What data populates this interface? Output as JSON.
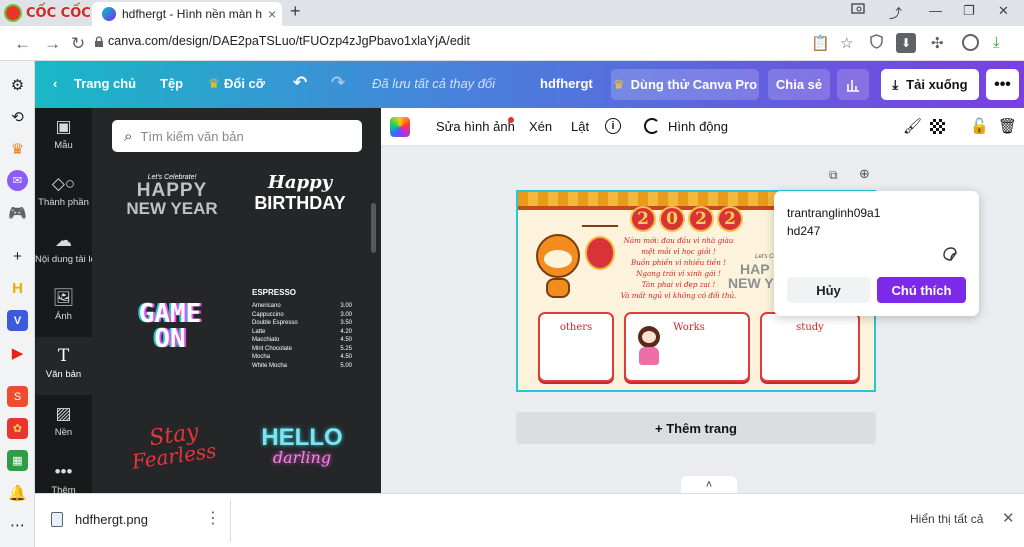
{
  "browser": {
    "brand": "CỐC CỐC",
    "tab_title": "hdfhergt - Hình nền màn hình",
    "url": "canva.com/design/DAE2paTSLuo/tFUOzp4zJgPbavo1xlaYjA/edit"
  },
  "canva_top": {
    "home": "Trang chủ",
    "file": "Tệp",
    "resize": "Đổi cỡ",
    "saved": "Đã lưu tất cả thay đổi",
    "design_name": "hdfhergt",
    "try_pro": "Dùng thử Canva Pro",
    "share": "Chia sẻ",
    "download": "Tải xuống"
  },
  "rail": {
    "items": [
      {
        "label": "Mẫu",
        "icon": "template-icon"
      },
      {
        "label": "Thành phần",
        "icon": "elements-icon"
      },
      {
        "label": "Nội dung tải lên",
        "icon": "upload-icon"
      },
      {
        "label": "Ảnh",
        "icon": "photo-icon"
      },
      {
        "label": "Văn bản",
        "icon": "text-icon"
      },
      {
        "label": "Nền",
        "icon": "background-icon"
      },
      {
        "label": "Thêm",
        "icon": "more-icon"
      }
    ]
  },
  "panel": {
    "search_placeholder": "Tìm kiếm văn bản",
    "templates": {
      "hny_small": "Let's Celebrate!",
      "hny_l1": "HAPPY",
      "hny_l2": "NEW YEAR",
      "hb_l1": "Happy",
      "hb_l2": "BIRTHDAY",
      "go_l1": "GAME",
      "go_l2": "ON",
      "menu_title": "ESPRESSO",
      "menu_items": [
        {
          "name": "Americano",
          "price": "3.00"
        },
        {
          "name": "Cappuccino",
          "price": "3.00"
        },
        {
          "name": "Double Espresso",
          "price": "3.50"
        },
        {
          "name": "Latte",
          "price": "4.20"
        },
        {
          "name": "Macchiato",
          "price": "4.50"
        },
        {
          "name": "Mint Chocolate",
          "price": "5.25"
        },
        {
          "name": "Mocha",
          "price": "4.50"
        },
        {
          "name": "White Mocha",
          "price": "5.00"
        }
      ],
      "sf_l1": "Stay",
      "sf_l2": "Fearless",
      "hd_l1": "HELLO",
      "hd_l2": "darling"
    }
  },
  "editor_toolbar": {
    "edit_image": "Sửa hình ảnh",
    "crop": "Xén",
    "flip": "Lật",
    "animate": "Hình động"
  },
  "design": {
    "year_digits": [
      "2",
      "0",
      "2",
      "2"
    ],
    "poem": [
      "Năm mới: đau đầu vì nhà giàu",
      "mệt mỏi vì học giỏi !",
      "Buồn phiền vì nhiều tiền !",
      "Ngang trái vì xinh gái !",
      "Tàn phai vì đẹp zai !",
      "Và mất ngủ vì không có đối thủ."
    ],
    "boxes": [
      "others",
      "Works",
      "study"
    ],
    "side_small": "Let's Celebrate!",
    "side_big_l1": "HAP",
    "side_big_l2": "NEW Y"
  },
  "comment": {
    "line1": "trantranglinh09a1",
    "line2": "hd247",
    "cancel": "Hủy",
    "submit": "Chú thích"
  },
  "add_page": "+ Thêm trang",
  "download_bar": {
    "file_name": "hdfhergt.png",
    "show_all": "Hiển thị tất cả"
  },
  "colors": {
    "accent_purple": "#7d2ae8",
    "accent_teal": "#00c4cc",
    "design_red": "#d42424"
  }
}
